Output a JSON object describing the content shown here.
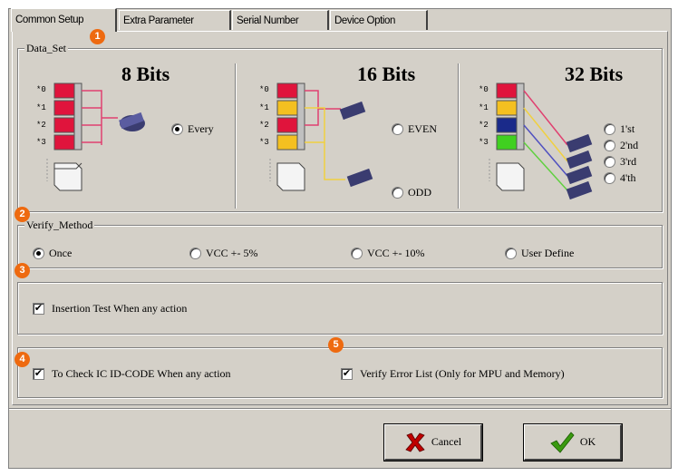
{
  "tabs": [
    {
      "label": "Common Setup",
      "active": true
    },
    {
      "label": "Extra Parameter",
      "active": false
    },
    {
      "label": "Serial Number",
      "active": false
    },
    {
      "label": "Device Option",
      "active": false
    }
  ],
  "badges": [
    "1",
    "2",
    "3",
    "4",
    "5"
  ],
  "data_set": {
    "legend": "Data_Set",
    "row_labels": [
      "*0",
      "*1",
      "*2",
      "*3"
    ],
    "bits8": {
      "title": "8 Bits",
      "option": "Every",
      "selected": true
    },
    "bits16": {
      "title": "16 Bits",
      "options": [
        "EVEN",
        "ODD"
      ]
    },
    "bits32": {
      "title": "32 Bits",
      "options": [
        "1'st",
        "2'nd",
        "3'rd",
        "4'th"
      ]
    }
  },
  "verify_method": {
    "legend": "Verify_Method",
    "options": [
      "Once",
      "VCC +- 5%",
      "VCC +- 10%",
      "User Define"
    ],
    "selected": "Once"
  },
  "insertion_test": {
    "label": "Insertion Test When any action",
    "checked": true
  },
  "check_id_code": {
    "label": "To Check IC ID-CODE When any action",
    "checked": true
  },
  "verify_error_list": {
    "label": "Verify Error List (Only for MPU and Memory)",
    "checked": true
  },
  "buttons": {
    "cancel": "Cancel",
    "ok": "OK"
  },
  "colors": {
    "panel": "#d4d0c8",
    "badge": "#ee6a10",
    "byte_red": "#e0143c",
    "byte_yellow": "#f4c020",
    "byte_blue": "#1a2a8a",
    "byte_green": "#40d020",
    "chip": "#3a3c70",
    "cancel_x": "#c00000",
    "ok_check": "#3a9a10"
  },
  "checkmark": "✔"
}
